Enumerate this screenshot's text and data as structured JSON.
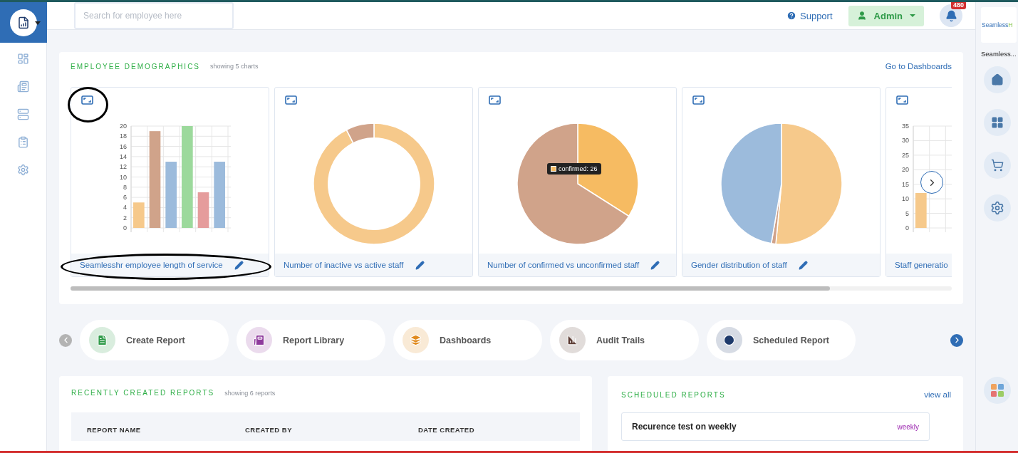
{
  "search": {
    "placeholder": "Search for employee here"
  },
  "header": {
    "support": "Support",
    "user": "Admin",
    "notifications": "480"
  },
  "demographics": {
    "title": "EMPLOYEE DEMOGRAPHICS",
    "subtitle": "showing 5 charts",
    "link": "Go to Dashboards",
    "charts": [
      {
        "kind": "bar",
        "title": "Seamlesshr employee length of service",
        "chart_data": {
          "type": "bar",
          "values": [
            5,
            19,
            13,
            20,
            7,
            13
          ],
          "ylim": [
            0,
            20
          ],
          "yticks": [
            0,
            2,
            4,
            6,
            8,
            10,
            12,
            14,
            16,
            18,
            20
          ],
          "grid": true
        }
      },
      {
        "kind": "donut",
        "title": "Number of inactive vs active staff"
      },
      {
        "kind": "pie",
        "title": "Number of confirmed vs unconfirmed staff",
        "tooltip": "confirmed: 26"
      },
      {
        "kind": "pie",
        "title": "Gender distribution of staff"
      },
      {
        "kind": "bar",
        "title": "Staff generatio",
        "chart_data": {
          "type": "bar",
          "values": [
            12
          ],
          "ylim": [
            0,
            35
          ],
          "yticks": [
            0,
            5,
            10,
            15,
            20,
            25,
            30,
            35
          ],
          "grid": true
        }
      }
    ]
  },
  "quick_links": [
    {
      "label": "Create Report",
      "color": "#2e9a48"
    },
    {
      "label": "Report Library",
      "color": "#8e3a9c"
    },
    {
      "label": "Dashboards",
      "color": "#e08a1e"
    },
    {
      "label": "Audit Trails",
      "color": "#5b3b33"
    },
    {
      "label": "Scheduled Report",
      "color": "#1e3a6b"
    }
  ],
  "recent_reports": {
    "title": "RECENTLY CREATED REPORTS",
    "subtitle": "showing 6 reports",
    "columns": [
      "REPORT NAME",
      "CREATED BY",
      "DATE CREATED"
    ]
  },
  "scheduled_reports": {
    "title": "SCHEDULED REPORTS",
    "link": "view all",
    "items": [
      {
        "name": "Recurence test on weekly",
        "frequency": "weekly"
      }
    ]
  },
  "right_rail": {
    "logo_primary": "Seamless",
    "logo_accent": "H",
    "app_name": "Seamless..."
  }
}
